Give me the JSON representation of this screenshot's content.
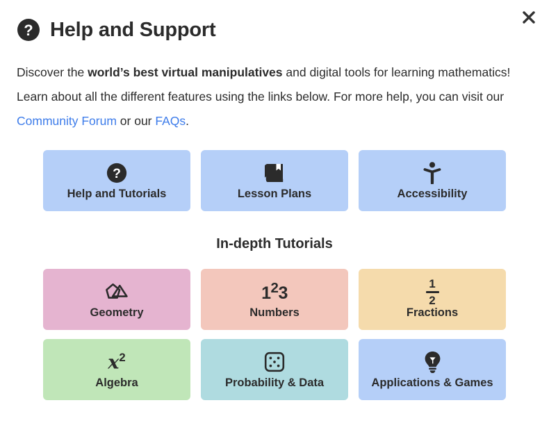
{
  "dialog": {
    "title": "Help and Support",
    "title_icon": "question-circle-icon",
    "close_label": "×"
  },
  "intro": {
    "part1": "Discover the ",
    "bold": "world’s best virtual manipulatives",
    "part2": " and digital tools for learning mathematics! Learn about all the different features using the links below. For more help, you can visit our ",
    "link1": "Community Forum",
    "part3": " or our ",
    "link2": "FAQs",
    "part4": "."
  },
  "primary_cards": [
    {
      "label": "Help and Tutorials",
      "icon": "question-circle-icon",
      "color": "#b5cff8"
    },
    {
      "label": "Lesson Plans",
      "icon": "book-bookmark-icon",
      "color": "#b5cff8"
    },
    {
      "label": "Accessibility",
      "icon": "accessibility-person-icon",
      "color": "#b5cff8"
    }
  ],
  "section": {
    "heading": "In-depth Tutorials"
  },
  "tutorial_cards": [
    {
      "label": "Geometry",
      "icon": "geometry-shapes-icon",
      "color": "#e5b4d0"
    },
    {
      "label": "Numbers",
      "icon": "numbers-123-icon",
      "color": "#f3c7bc",
      "glyph_1": "1",
      "glyph_2": "2",
      "glyph_3": "3"
    },
    {
      "label": "Fractions",
      "icon": "fraction-one-half-icon",
      "color": "#f5dbac",
      "numerator": "1",
      "denominator": "2"
    },
    {
      "label": "Algebra",
      "icon": "x-squared-icon",
      "color": "#c0e6b8",
      "base": "x",
      "exponent": "2"
    },
    {
      "label": "Probability & Data",
      "icon": "dice-icon",
      "color": "#afdbe0"
    },
    {
      "label": "Applications & Games",
      "icon": "lightbulb-icon",
      "color": "#b5cff8"
    }
  ]
}
